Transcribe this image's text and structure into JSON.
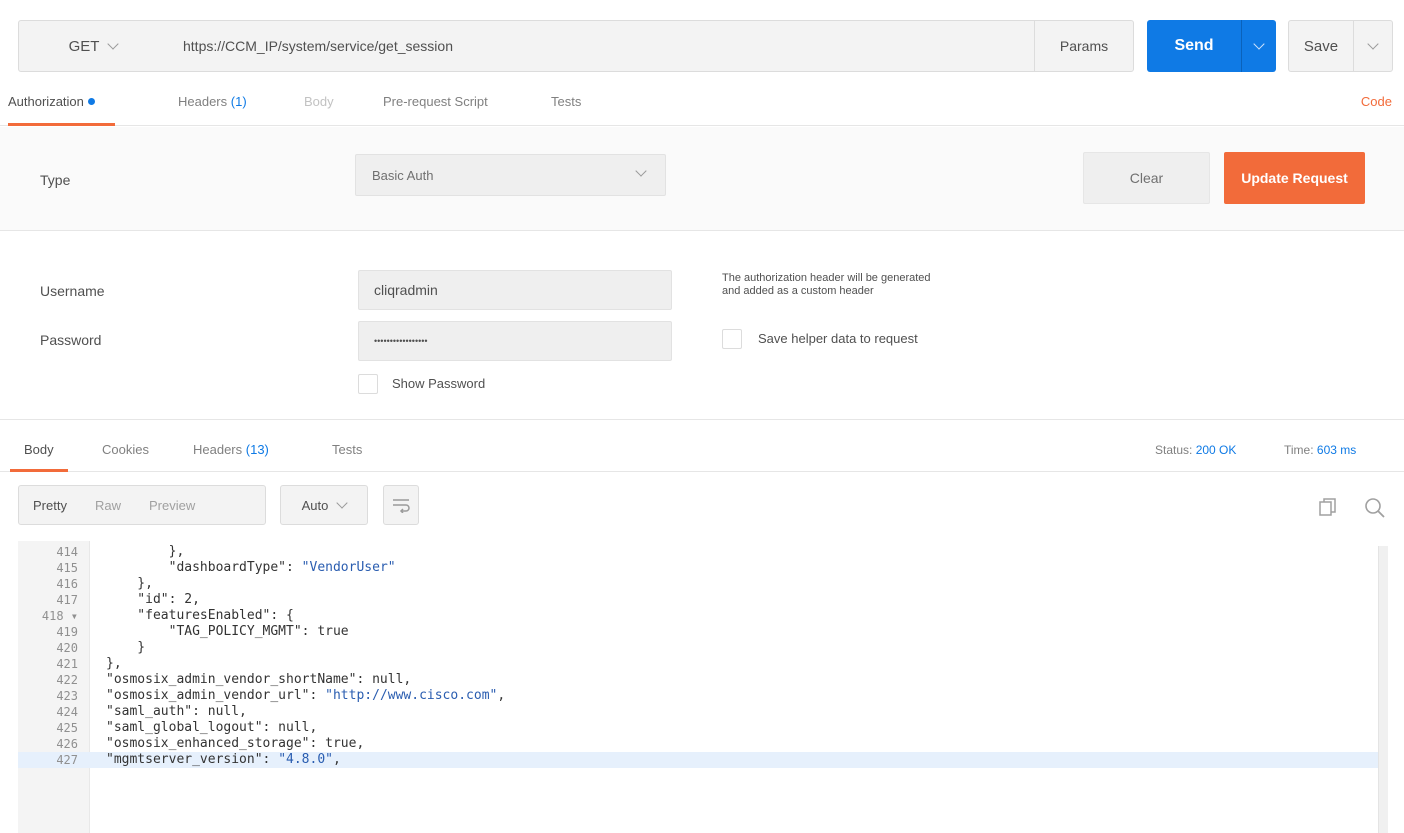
{
  "request": {
    "method": "GET",
    "url": "https://CCM_IP/system/service/get_session",
    "params_label": "Params",
    "send_label": "Send",
    "save_label": "Save"
  },
  "request_tabs": {
    "authorization": "Authorization",
    "headers": "Headers",
    "headers_count": "(1)",
    "body": "Body",
    "prerequest": "Pre-request Script",
    "tests": "Tests",
    "code": "Code"
  },
  "auth": {
    "type_label": "Type",
    "type_value": "Basic Auth",
    "clear_label": "Clear",
    "update_label": "Update Request",
    "username_label": "Username",
    "username_value": "cliqradmin",
    "password_label": "Password",
    "password_value": "•••••••••••••••••",
    "show_password_label": "Show Password",
    "help_line1": "The authorization header will be generated",
    "help_line2": "and added as a custom header",
    "save_helper_label": "Save helper data to request"
  },
  "response_tabs": {
    "body": "Body",
    "cookies": "Cookies",
    "headers": "Headers",
    "headers_count": "(13)",
    "tests": "Tests",
    "status_label": "Status:",
    "status_value": "200 OK",
    "time_label": "Time:",
    "time_value": "603 ms"
  },
  "response_tools": {
    "pretty": "Pretty",
    "raw": "Raw",
    "preview": "Preview",
    "format": "Auto"
  },
  "code_lines": [
    {
      "n": "414",
      "t": "        },"
    },
    {
      "n": "415",
      "t": "        \"dashboardType\": \"VendorUser\""
    },
    {
      "n": "416",
      "t": "    },"
    },
    {
      "n": "417",
      "t": "    \"id\": 2,"
    },
    {
      "n": "418 ▾",
      "t": "    \"featuresEnabled\": {"
    },
    {
      "n": "419",
      "t": "        \"TAG_POLICY_MGMT\": true"
    },
    {
      "n": "420",
      "t": "    }"
    },
    {
      "n": "421",
      "t": "},"
    },
    {
      "n": "422",
      "t": "\"osmosix_admin_vendor_shortName\": null,"
    },
    {
      "n": "423",
      "t": "\"osmosix_admin_vendor_url\": \"http://www.cisco.com\","
    },
    {
      "n": "424",
      "t": "\"saml_auth\": null,"
    },
    {
      "n": "425",
      "t": "\"saml_global_logout\": null,"
    },
    {
      "n": "426",
      "t": "\"osmosix_enhanced_storage\": true,"
    },
    {
      "n": "427",
      "t": "\"mgmtserver_version\": \"4.8.0\","
    }
  ],
  "colors": {
    "accent_blue": "#0f7ae5",
    "accent_orange": "#f26b3a"
  },
  "icons": [
    "chevron-down-icon",
    "wrap-lines-icon",
    "copy-icon",
    "search-icon"
  ]
}
